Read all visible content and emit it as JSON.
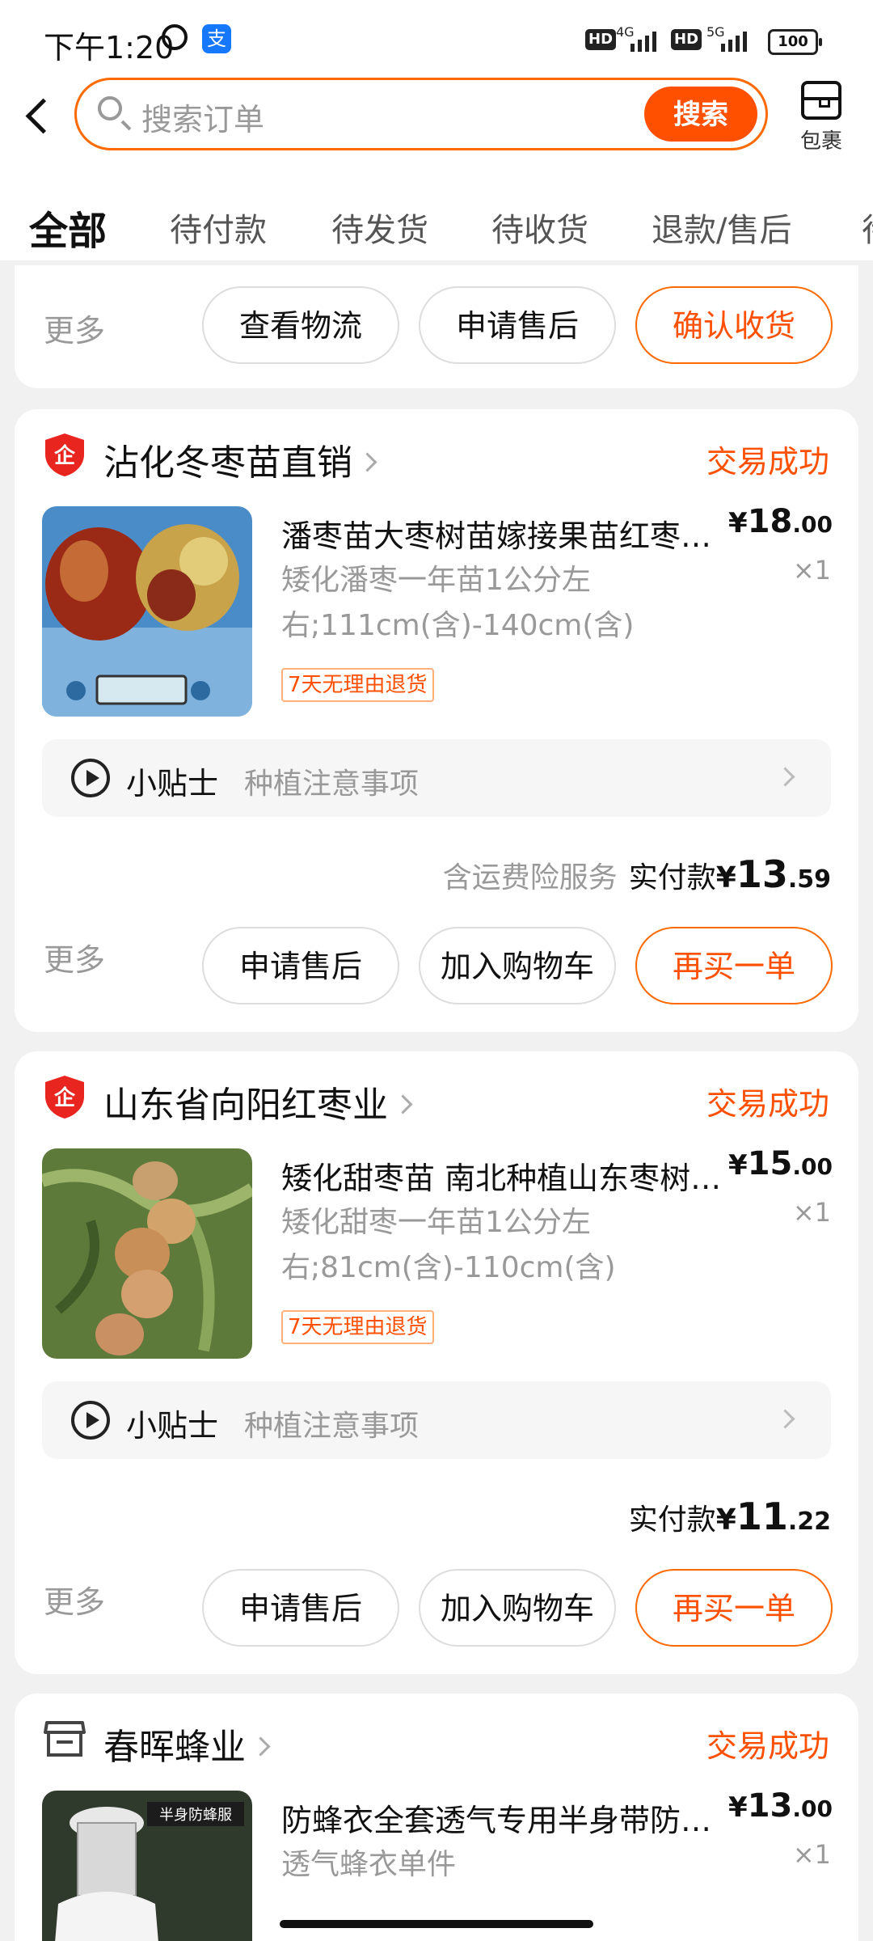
{
  "status_bar": {
    "time": "下午1:20",
    "alipay_glyph": "支",
    "hd1": "HD",
    "net1": "4G",
    "hd2": "HD",
    "net2": "5G",
    "battery": "100"
  },
  "header": {
    "search_placeholder": "搜索订单",
    "search_button": "搜索",
    "package_label": "包裹",
    "icons": [
      "back-icon",
      "search-icon",
      "package-icon"
    ]
  },
  "tabs": [
    {
      "label": "全部",
      "active": true
    },
    {
      "label": "待付款"
    },
    {
      "label": "待发货"
    },
    {
      "label": "待收货"
    },
    {
      "label": "退款/售后"
    },
    {
      "label": "待"
    }
  ],
  "top_card": {
    "more": "更多",
    "buttons": [
      "查看物流",
      "申请售后",
      "确认收货"
    ]
  },
  "orders": [
    {
      "shop": "沾化冬枣苗直销",
      "shop_icon": "enterprise-shield-icon",
      "status": "交易成功",
      "title": "潘枣苗大枣树苗嫁接果苗红枣…",
      "sku": "矮化潘枣一年苗1公分左右;111cm(含)-140cm(含)",
      "badge": "7天无理由退货",
      "price_symbol": "¥",
      "price_int": "18",
      "price_dec": ".00",
      "qty": "×1",
      "tip_label": "小贴士",
      "tip_text": "种植注意事项",
      "pay_note": "含运费险服务",
      "pay_label": "实付款",
      "pay_symbol": "¥",
      "pay_int": "13",
      "pay_dec": ".59",
      "more": "更多",
      "buttons": [
        "申请售后",
        "加入购物车",
        "再买一单"
      ]
    },
    {
      "shop": "山东省向阳红枣业",
      "shop_icon": "enterprise-shield-icon",
      "status": "交易成功",
      "title": "矮化甜枣苗 南北种植山东枣树…",
      "sku": "矮化甜枣一年苗1公分左右;81cm(含)-110cm(含)",
      "badge": "7天无理由退货",
      "price_symbol": "¥",
      "price_int": "15",
      "price_dec": ".00",
      "qty": "×1",
      "tip_label": "小贴士",
      "tip_text": "种植注意事项",
      "pay_label": "实付款",
      "pay_symbol": "¥",
      "pay_int": "11",
      "pay_dec": ".22",
      "more": "更多",
      "buttons": [
        "申请售后",
        "加入购物车",
        "再买一单"
      ]
    },
    {
      "shop": "春晖蜂业",
      "shop_icon": "store-icon",
      "status": "交易成功",
      "title": "防蜂衣全套透气专用半身带防…",
      "sku": "透气蜂衣单件",
      "price_symbol": "¥",
      "price_int": "13",
      "price_dec": ".00",
      "qty": "×1",
      "thumb_text": "半身防蜂服"
    }
  ],
  "colors": {
    "accent": "#ff5000",
    "enterprise_red": "#e8251e"
  }
}
